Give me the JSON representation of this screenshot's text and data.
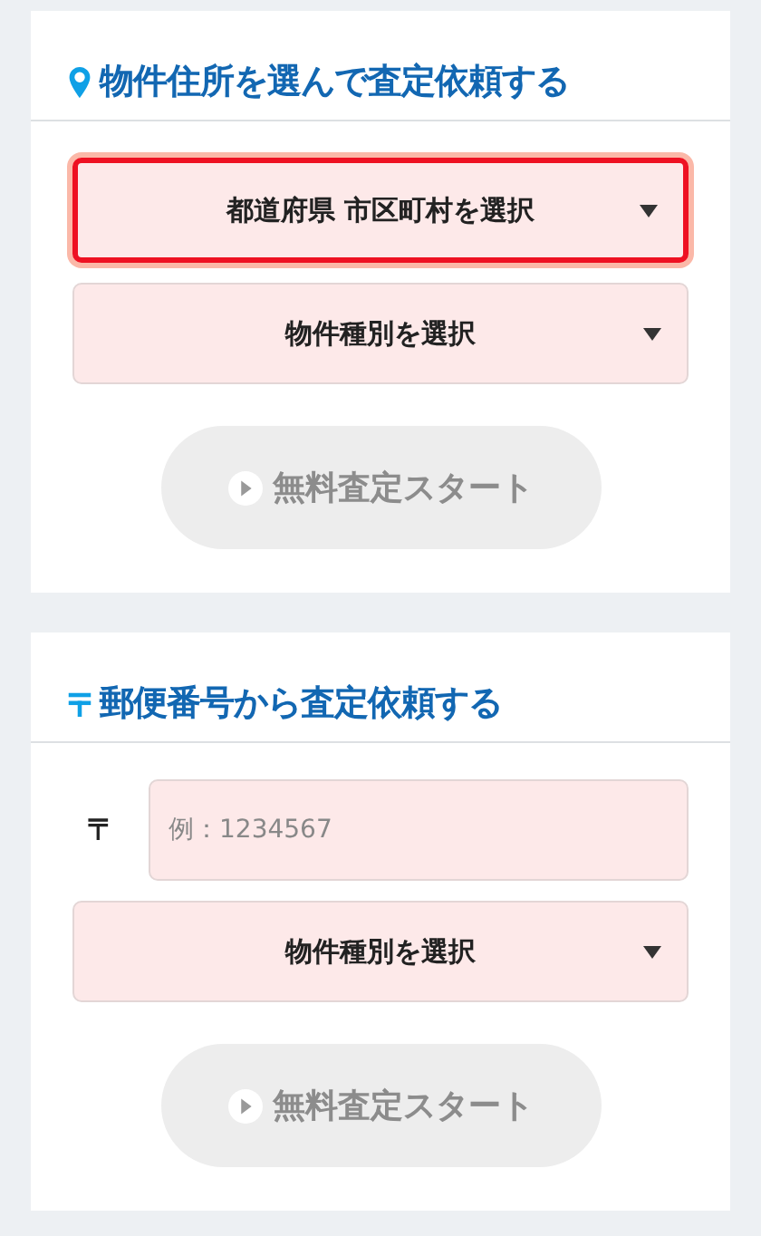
{
  "sections": [
    {
      "kind": "address",
      "title": "物件住所を選んで査定依頼する",
      "fields": [
        {
          "kind": "select",
          "label": "都道府県 市区町村を選択",
          "highlighted": true
        },
        {
          "kind": "select",
          "label": "物件種別を選択",
          "highlighted": false
        }
      ],
      "button": {
        "label": "無料査定スタート",
        "disabled": true
      }
    },
    {
      "kind": "postal",
      "title": "郵便番号から査定依頼する",
      "fields": [
        {
          "kind": "input",
          "prefix": "〒",
          "placeholder": "例：1234567",
          "highlighted": false
        },
        {
          "kind": "select",
          "label": "物件種別を選択",
          "highlighted": false
        }
      ],
      "button": {
        "label": "無料査定スタート",
        "disabled": true
      }
    }
  ]
}
